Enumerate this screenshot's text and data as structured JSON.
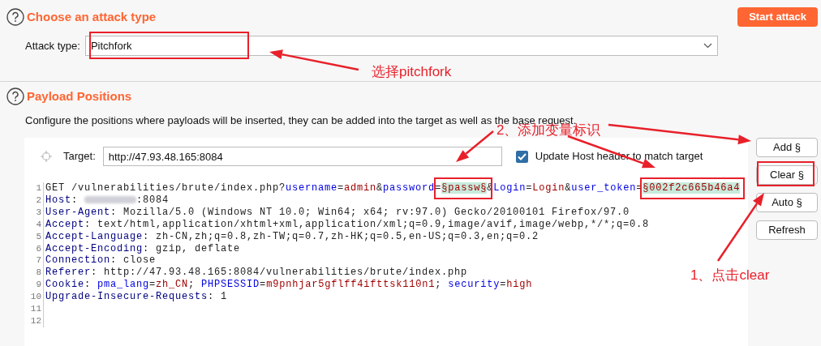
{
  "attack_section": {
    "title": "Choose an attack type",
    "start_button": "Start attack",
    "attack_type_label": "Attack type:",
    "attack_type_value": "Pitchfork"
  },
  "positions_section": {
    "title": "Payload Positions",
    "description": "Configure the positions where payloads will be inserted, they can be added into the target as well as the base request."
  },
  "target": {
    "label": "Target:",
    "value": "http://47.93.48.165:8084",
    "update_host": {
      "label": "Update Host header to match target",
      "checked": true
    }
  },
  "request_lines": [
    {
      "number": "1",
      "tokens": [
        {
          "text": "GET /vulnerabilities/brute/index.php?",
          "kind": "plain"
        },
        {
          "text": "username",
          "kind": "param"
        },
        {
          "text": "=",
          "kind": "plain"
        },
        {
          "text": "admin",
          "kind": "value"
        },
        {
          "text": "&",
          "kind": "plain"
        },
        {
          "text": "password",
          "kind": "param"
        },
        {
          "text": "=",
          "kind": "plain"
        },
        {
          "text": "§passw§",
          "kind": "marker"
        },
        {
          "text": "&",
          "kind": "plain"
        },
        {
          "text": "Login",
          "kind": "param"
        },
        {
          "text": "=",
          "kind": "plain"
        },
        {
          "text": "Login",
          "kind": "value"
        },
        {
          "text": "&",
          "kind": "plain"
        },
        {
          "text": "user_token",
          "kind": "param"
        },
        {
          "text": "=",
          "kind": "plain"
        },
        {
          "text": "§002f2c665b46a4",
          "kind": "marker"
        }
      ]
    },
    {
      "number": "2",
      "tokens": [
        {
          "text": "Host",
          "kind": "header"
        },
        {
          "text": ": ",
          "kind": "plain"
        },
        {
          "kind": "blurred"
        },
        {
          "text": ":8084",
          "kind": "plain"
        }
      ]
    },
    {
      "number": "3",
      "tokens": [
        {
          "text": "User-Agent",
          "kind": "header"
        },
        {
          "text": ": Mozilla/5.0 (Windows NT 10.0; Win64; x64; rv:97.0) Gecko/20100101 Firefox/97.0",
          "kind": "plain"
        }
      ]
    },
    {
      "number": "4",
      "tokens": [
        {
          "text": "Accept",
          "kind": "header"
        },
        {
          "text": ": text/html,application/xhtml+xml,application/xml;q=0.9,image/avif,image/webp,*/*;q=0.8",
          "kind": "plain"
        }
      ]
    },
    {
      "number": "5",
      "tokens": [
        {
          "text": "Accept-Language",
          "kind": "header"
        },
        {
          "text": ": zh-CN,zh;q=0.8,zh-TW;q=0.7,zh-HK;q=0.5,en-US;q=0.3,en;q=0.2",
          "kind": "plain"
        }
      ]
    },
    {
      "number": "6",
      "tokens": [
        {
          "text": "Accept-Encoding",
          "kind": "header"
        },
        {
          "text": ": gzip, deflate",
          "kind": "plain"
        }
      ]
    },
    {
      "number": "7",
      "tokens": [
        {
          "text": "Connection",
          "kind": "header"
        },
        {
          "text": ": close",
          "kind": "plain"
        }
      ]
    },
    {
      "number": "8",
      "tokens": [
        {
          "text": "Referer",
          "kind": "header"
        },
        {
          "text": ": http://47.93.48.165:8084/vulnerabilities/brute/index.php",
          "kind": "plain"
        }
      ]
    },
    {
      "number": "9",
      "tokens": [
        {
          "text": "Cookie",
          "kind": "header"
        },
        {
          "text": ": ",
          "kind": "plain"
        },
        {
          "text": "pma_lang",
          "kind": "param"
        },
        {
          "text": "=",
          "kind": "plain"
        },
        {
          "text": "zh_CN",
          "kind": "value"
        },
        {
          "text": "; ",
          "kind": "plain"
        },
        {
          "text": "PHPSESSID",
          "kind": "param"
        },
        {
          "text": "=",
          "kind": "plain"
        },
        {
          "text": "m9pnhjar5gflff4ifttsk110n1",
          "kind": "value"
        },
        {
          "text": "; ",
          "kind": "plain"
        },
        {
          "text": "security",
          "kind": "param"
        },
        {
          "text": "=",
          "kind": "plain"
        },
        {
          "text": "high",
          "kind": "value"
        }
      ]
    },
    {
      "number": "10",
      "tokens": [
        {
          "text": "Upgrade-Insecure-Requests",
          "kind": "header"
        },
        {
          "text": ": 1",
          "kind": "plain"
        }
      ]
    },
    {
      "number": "11"
    },
    {
      "number": "12"
    }
  ],
  "side_buttons": [
    "Add §",
    "Clear §",
    "Auto §",
    "Refresh"
  ],
  "annotations": [
    "选择pitchfork",
    "2、添加变量标识",
    "1、点击clear"
  ]
}
